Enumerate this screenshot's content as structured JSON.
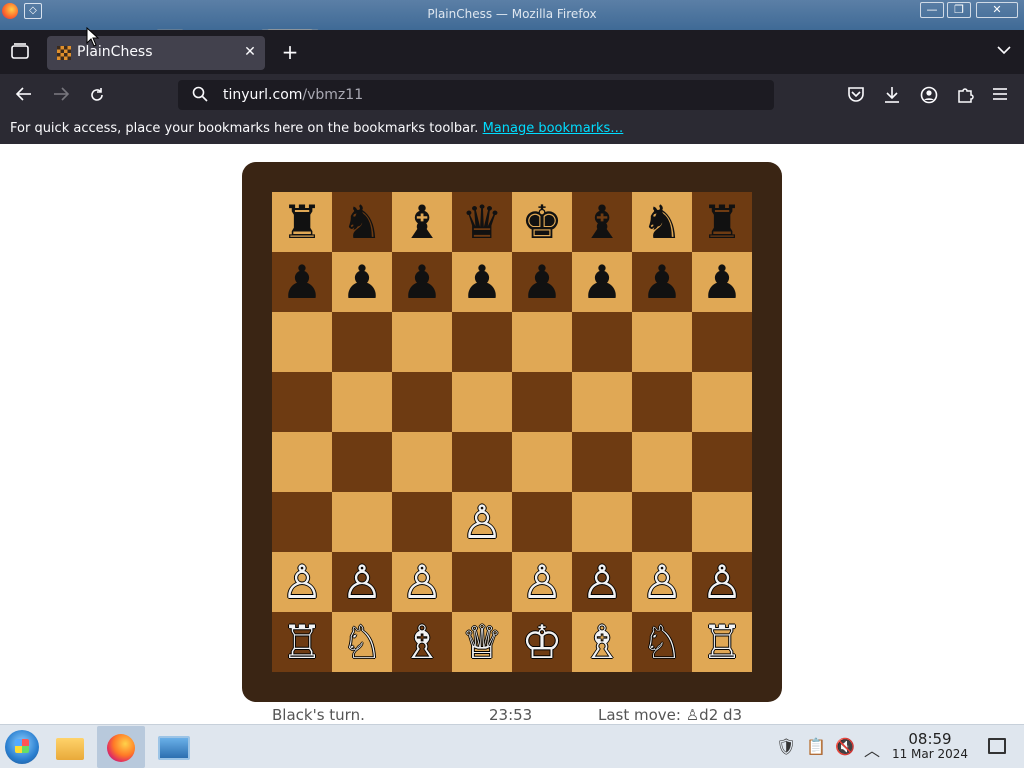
{
  "window": {
    "title": "PlainChess — Mozilla Firefox",
    "minimize_glyph": "—",
    "restore_glyph": "❐",
    "close_glyph": "✕"
  },
  "tabs": [
    {
      "label": "PlainChess",
      "favicon": "checkerboard-icon",
      "active": true
    }
  ],
  "tab_close_glyph": "✕",
  "new_tab_glyph": "+",
  "navbar": {
    "url_host": "tinyurl.com",
    "url_path": "/vbmz11"
  },
  "bookmarks_bar": {
    "message": "For quick access, place your bookmarks here on the bookmarks toolbar.",
    "link": "Manage bookmarks…"
  },
  "game": {
    "board_colors": {
      "light": "#e0a855",
      "dark": "#6e3b12",
      "frame": "#3a2514"
    },
    "rows": [
      [
        "♜",
        "♞",
        "♝",
        "♛",
        "♚",
        "♝",
        "♞",
        "♜"
      ],
      [
        "♟",
        "♟",
        "♟",
        "♟",
        "♟",
        "♟",
        "♟",
        "♟"
      ],
      [
        "",
        "",
        "",
        "",
        "",
        "",
        "",
        ""
      ],
      [
        "",
        "",
        "",
        "",
        "",
        "",
        "",
        ""
      ],
      [
        "",
        "",
        "",
        "",
        "",
        "",
        "",
        ""
      ],
      [
        "",
        "",
        "",
        "♙",
        "",
        "",
        "",
        ""
      ],
      [
        "♙",
        "♙",
        "♙",
        "",
        "♙",
        "♙",
        "♙",
        "♙"
      ],
      [
        "♖",
        "♘",
        "♗",
        "♕",
        "♔",
        "♗",
        "♘",
        "♖"
      ]
    ],
    "status": {
      "turn": "Black's turn.",
      "clock": "23:53",
      "last_move": "Last move: ♙d2 d3"
    }
  },
  "taskbar": {
    "apps": [
      "file-manager-icon",
      "firefox-icon",
      "control-panel-icon"
    ],
    "time": "08:59",
    "date": "11 Mar 2024"
  }
}
